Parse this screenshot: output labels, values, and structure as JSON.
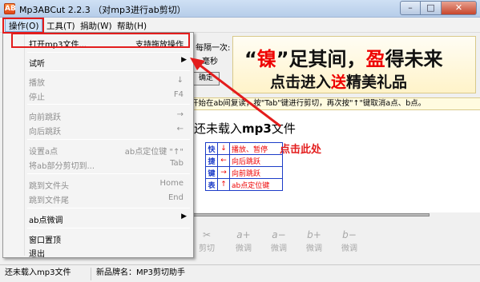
{
  "window": {
    "title": "Mp3ABCut 2.2.3 （对mp3进行ab剪切）",
    "icon_text": "AB"
  },
  "menubar": {
    "items": [
      {
        "label": "操作(O)"
      },
      {
        "label": "工具(T)"
      },
      {
        "label": "捐助(W)"
      },
      {
        "label": "帮助(H)"
      }
    ]
  },
  "dropdown": {
    "open_file": {
      "label": "打开mp3文件...",
      "shortcut": "支持拖放操作"
    },
    "listen": {
      "label": "试听"
    },
    "play": {
      "label": "播放",
      "shortcut": "↓"
    },
    "stop": {
      "label": "停止",
      "shortcut": "F4"
    },
    "seek_forward": {
      "label": "向前跳跃",
      "shortcut": "→"
    },
    "seek_back": {
      "label": "向后跳跃",
      "shortcut": "←"
    },
    "set_a": {
      "label": "设置a点",
      "shortcut": "ab点定位键 \"↑\""
    },
    "cut_ab": {
      "label": "将ab部分剪切到...",
      "shortcut": "Tab"
    },
    "goto_start": {
      "label": "跳到文件头",
      "shortcut": "Home"
    },
    "goto_end": {
      "label": "跳到文件尾",
      "shortcut": "End"
    },
    "ab_finetune": {
      "label": "ab点微调"
    },
    "topmost": {
      "label": "窗口置顶"
    },
    "exit": {
      "label": "退出"
    }
  },
  "main": {
    "timer_label": "每隔一次:",
    "timer_unit": "毫秒",
    "button_label": "确定",
    "banner": {
      "line1_a": "“",
      "line1_red1": "镍",
      "line1_b": "”足其间，",
      "line1_red2": "盈",
      "line1_c": "得未来",
      "line2_a": "点击进入",
      "line2_red": "送",
      "line2_b": "精美礼品"
    },
    "tip": "开始在ab间复读，按\"Tab\"键进行剪切，再次按\"↑\"键取消a点、b点。",
    "file_status_prefix": "还未载入",
    "file_status_bold": "mp3",
    "file_status_suffix": "文件",
    "hotkeys": {
      "side": [
        "快",
        "捷",
        "键",
        "表"
      ],
      "rows": [
        {
          "key": "↓",
          "desc": "播放、暂停"
        },
        {
          "key": "←",
          "desc": "向后跳跃"
        },
        {
          "key": "→",
          "desc": "向前跳跃"
        },
        {
          "key": "↑",
          "desc": "ab点定位键"
        }
      ]
    },
    "annotation": "点击此处"
  },
  "toolbar": {
    "cut": {
      "glyph": "✂",
      "label": "剪切"
    },
    "a_plus": {
      "glyph": "a+",
      "label": "微调"
    },
    "a_minus": {
      "glyph": "a−",
      "label": "微调"
    },
    "b_plus": {
      "glyph": "b+",
      "label": "微调"
    },
    "b_minus": {
      "glyph": "b−",
      "label": "微调"
    }
  },
  "statusbar": {
    "left": "还未载入mp3文件",
    "right": "新品牌名：MP3剪切助手"
  },
  "colors": {
    "annotation_red": "#e31c1c",
    "hotkey_blue": "#1c3cc8",
    "menu_highlight": "#cfe3f8"
  },
  "icons": {
    "app": "app-icon",
    "submenu": "chevron-right-icon",
    "cut": "scissors-icon"
  }
}
